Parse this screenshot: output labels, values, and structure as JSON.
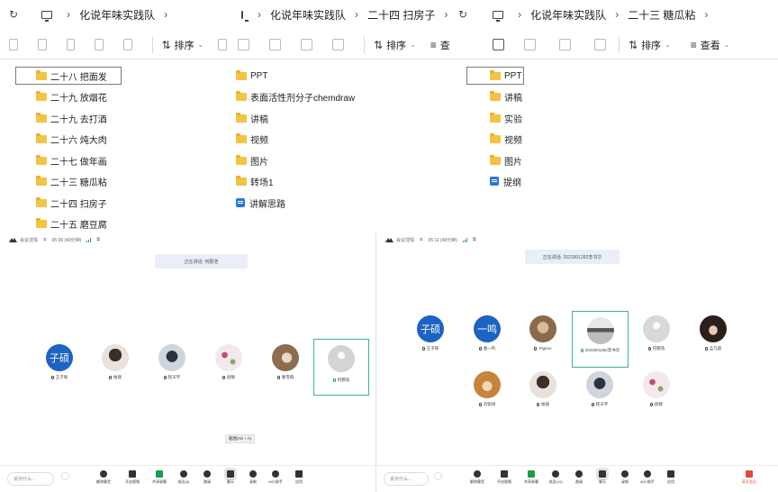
{
  "explorer_panes": [
    {
      "breadcrumb": [
        "化说年味实践队"
      ],
      "sort_label": "排序",
      "view_label": "",
      "items": [
        {
          "name": "二十八 把面发",
          "icon": "folder-icon",
          "selected": true
        },
        {
          "name": "二十九 放烟花",
          "icon": "folder-icon"
        },
        {
          "name": "二十九 去打酒",
          "icon": "folder-icon"
        },
        {
          "name": "二十六 炖大肉",
          "icon": "folder-icon"
        },
        {
          "name": "二十七 做年画",
          "icon": "folder-icon"
        },
        {
          "name": "二十三 糖瓜粘",
          "icon": "folder-icon"
        },
        {
          "name": "二十四 扫房子",
          "icon": "folder-icon"
        },
        {
          "name": "二十五 磨豆腐",
          "icon": "folder-icon"
        }
      ]
    },
    {
      "breadcrumb": [
        "化说年味实践队",
        "二十四 扫房子"
      ],
      "sort_label": "排序",
      "view_label": "查",
      "items": [
        {
          "name": "PPT",
          "icon": "folder-icon"
        },
        {
          "name": "表面活性剂分子chemdraw",
          "icon": "folder-icon"
        },
        {
          "name": "讲稿",
          "icon": "folder-icon"
        },
        {
          "name": "视频",
          "icon": "folder-icon"
        },
        {
          "name": "图片",
          "icon": "folder-icon"
        },
        {
          "name": "转场1",
          "icon": "folder-icon"
        },
        {
          "name": "讲解思路",
          "icon": "document-icon"
        }
      ]
    },
    {
      "breadcrumb": [
        "化说年味实践队",
        "二十三 糖瓜粘"
      ],
      "sort_label": "排序",
      "view_label": "查看",
      "items": [
        {
          "name": "PPT",
          "icon": "folder-icon",
          "selected": true
        },
        {
          "name": "讲稿",
          "icon": "folder-icon"
        },
        {
          "name": "实验",
          "icon": "folder-icon"
        },
        {
          "name": "视频",
          "icon": "folder-icon"
        },
        {
          "name": "图片",
          "icon": "folder-icon"
        },
        {
          "name": "提纲",
          "icon": "document-icon"
        }
      ]
    }
  ],
  "meetings": [
    {
      "header": {
        "meeting_details": "会议详情",
        "timer": "05:30 (40分钟)"
      },
      "speaking": "正在讲话: 何鄞浩",
      "screenshot_hint": "截图(Alt + A)",
      "participants": [
        {
          "name": "王子硕",
          "avatar_text": "子硕",
          "avatar_color": "#1d63c2"
        },
        {
          "name": "柏丽",
          "avatar_text": "",
          "avatar_color": "#d9cfc4"
        },
        {
          "name": "程天宇",
          "avatar_text": "",
          "avatar_color": "#c5cbd6"
        },
        {
          "name": "颜静",
          "avatar_text": "",
          "avatar_color": "#f1e4ea"
        },
        {
          "name": "秦雪薇",
          "avatar_text": "",
          "avatar_color": "#a88b6a"
        },
        {
          "name": "何鄞浩",
          "avatar_text": "",
          "avatar_color": "#d6d6d6",
          "active": true
        }
      ],
      "chat_placeholder": "说点什么...",
      "toolbar": [
        "解除静音",
        "开启视频",
        "共享屏幕",
        "成员(6)",
        "邀请",
        "聊天",
        "录制",
        "AI小助手",
        "应用"
      ],
      "leave_label": ""
    },
    {
      "header": {
        "meeting_details": "会议详情",
        "timer": "05:11 (40分钟)"
      },
      "speaking": "正在讲话: 2023301282李书华",
      "screenshot_hint": "",
      "participants": [
        {
          "name": "王子硕",
          "avatar_text": "子硕",
          "avatar_color": "#1d63c2"
        },
        {
          "name": "童一鸣",
          "avatar_text": "一鸣",
          "avatar_color": "#1d63c2"
        },
        {
          "name": "Pigeon",
          "avatar_text": "",
          "avatar_color": "#b79a7e"
        },
        {
          "name": "2023301282李书华",
          "avatar_text": "",
          "avatar_color": "#9a9a9a",
          "active": true
        },
        {
          "name": "何鄞浩",
          "avatar_text": "",
          "avatar_color": "#d6d6d6"
        },
        {
          "name": "孟凡森",
          "avatar_text": "",
          "avatar_color": "#3a2a26"
        },
        {
          "name": "刘锐妍",
          "avatar_text": "",
          "avatar_color": "#c8843e"
        },
        {
          "name": "柏丽",
          "avatar_text": "",
          "avatar_color": "#d9cfc4"
        },
        {
          "name": "程天宇",
          "avatar_text": "",
          "avatar_color": "#c5cbd6"
        },
        {
          "name": "颜静",
          "avatar_text": "",
          "avatar_color": "#f1e4ea"
        }
      ],
      "chat_placeholder": "说点什么...",
      "toolbar": [
        "解除静音",
        "开启视频",
        "共享屏幕",
        "成员(10)",
        "邀请",
        "聊天",
        "录制",
        "AI小助手",
        "应用"
      ],
      "leave_label": "离开会议"
    }
  ]
}
